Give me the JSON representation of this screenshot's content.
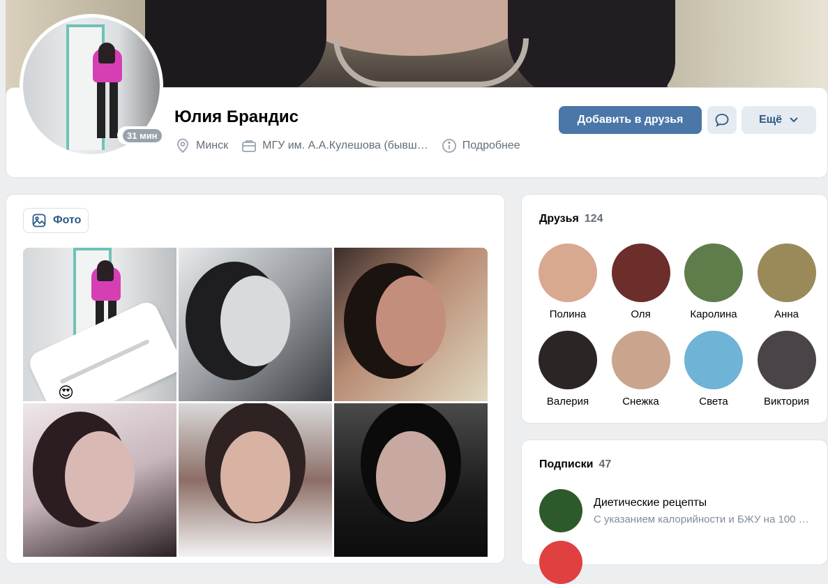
{
  "profile": {
    "name": "Юлия Брандис",
    "online": "31 мин",
    "city": "Минск",
    "university": "МГУ им. А.А.Кулешова (бывш…",
    "details": "Подробнее"
  },
  "actions": {
    "add_friend": "Добавить в друзья",
    "more": "Ещё"
  },
  "photos": {
    "tab_label": "Фото",
    "emoji": "😍"
  },
  "friends": {
    "title": "Друзья",
    "count": "124",
    "items": [
      {
        "name": "Полина",
        "color": "#d9a890"
      },
      {
        "name": "Оля",
        "color": "#6b2e2a"
      },
      {
        "name": "Каролина",
        "color": "#5e7d4a"
      },
      {
        "name": "Анна",
        "color": "#9a8a5a"
      },
      {
        "name": "Валерия",
        "color": "#2b2524"
      },
      {
        "name": "Снежка",
        "color": "#c9a58e"
      },
      {
        "name": "Света",
        "color": "#6fb3d6"
      },
      {
        "name": "Виктория",
        "color": "#4a4448"
      }
    ]
  },
  "subscriptions": {
    "title": "Подписки",
    "count": "47",
    "items": [
      {
        "title": "Диетические рецепты",
        "desc": "С указанием калорийности и БЖУ на 100 …",
        "color": "#2d5a2a"
      },
      {
        "title": "",
        "desc": "",
        "color": "#e04040"
      }
    ]
  },
  "colors": {
    "accent": "#4a76a8",
    "secondary_button": "#e5ebf1",
    "link": "#2c5987"
  }
}
